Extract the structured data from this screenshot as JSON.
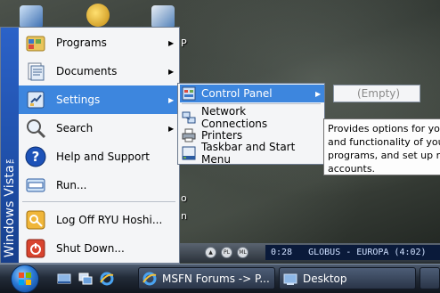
{
  "start_menu": {
    "brand": "Windows Vista™",
    "items": [
      {
        "label": "Programs",
        "icon": "programs-icon",
        "has_submenu": true
      },
      {
        "label": "Documents",
        "icon": "documents-icon",
        "has_submenu": true
      },
      {
        "label": "Settings",
        "icon": "settings-icon",
        "has_submenu": true,
        "active": true
      },
      {
        "label": "Search",
        "icon": "search-icon",
        "has_submenu": true
      },
      {
        "label": "Help and Support",
        "icon": "help-icon",
        "has_submenu": false
      },
      {
        "label": "Run...",
        "icon": "run-icon",
        "has_submenu": false
      },
      {
        "label": "Log Off RYU Hoshi...",
        "icon": "log-off-icon",
        "has_submenu": false
      },
      {
        "label": "Shut Down...",
        "icon": "shutdown-icon",
        "has_submenu": false
      }
    ]
  },
  "settings_submenu": {
    "items": [
      {
        "label": "Control Panel",
        "icon": "control-panel-icon",
        "active": true
      },
      {
        "label": "Network Connections",
        "icon": "network-connections-icon"
      },
      {
        "label": "Printers",
        "icon": "printers-icon"
      },
      {
        "label": "Taskbar and Start Menu",
        "icon": "taskbar-icon"
      }
    ]
  },
  "control_panel_submenu": {
    "empty_label": "(Empty)"
  },
  "tooltip": {
    "lines": [
      "Provides options for you",
      "and functionality of you",
      "programs, and set up ne",
      "accounts."
    ]
  },
  "media_bar": {
    "buttons": [
      "eject",
      "PL",
      "ML"
    ],
    "time": "0:28",
    "track": "GLOBUS - EUROPA (4:02)"
  },
  "taskbar": {
    "tasks": [
      {
        "label": "MSFN Forums -> P...",
        "icon": "browser-icon"
      },
      {
        "label": "Desktop",
        "icon": "folder-icon"
      }
    ]
  },
  "desktop": {
    "fragment_top": "P",
    "fragment_mid": "o",
    "fragment_low": "n"
  },
  "colors": {
    "highlight": "#3d86de",
    "vista_band": "#2b62c8"
  }
}
